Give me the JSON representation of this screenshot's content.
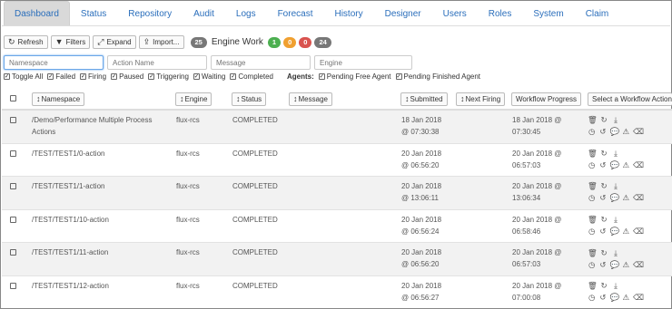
{
  "tabs": [
    "Dashboard",
    "Status",
    "Repository",
    "Audit",
    "Logs",
    "Forecast",
    "History",
    "Designer",
    "Users",
    "Roles",
    "System",
    "Claim"
  ],
  "active_tab": "Dashboard",
  "toolbar": {
    "refresh": "Refresh",
    "filters": "Filters",
    "expand": "Expand",
    "import": "Import...",
    "engine_count": "25",
    "engine_label": "Engine Work",
    "badge_green": "1",
    "badge_orange": "0",
    "badge_red": "0",
    "badge_gray": "24"
  },
  "filter_placeholders": {
    "namespace": "Namespace",
    "action_name": "Action Name",
    "message": "Message",
    "engine": "Engine"
  },
  "checkboxes": [
    "Toggle All",
    "Failed",
    "Firing",
    "Paused",
    "Triggering",
    "Waiting",
    "Completed"
  ],
  "agents_label": "Agents:",
  "agent_checkboxes": [
    "Pending Free Agent",
    "Pending Finished Agent"
  ],
  "columns": {
    "namespace": "Namespace",
    "engine": "Engine",
    "status": "Status",
    "message": "Message",
    "submitted": "Submitted",
    "next_firing": "Next Firing",
    "workflow_progress": "Workflow Progress",
    "select_action": "Select a Workflow Action"
  },
  "rows": [
    {
      "namespace": "/Demo/Performance Multiple Process",
      "namespace2": "Actions",
      "engine": "flux-rcs",
      "status": "COMPLETED",
      "submitted": "18 Jan 2018",
      "submitted2": "@ 07:30:38",
      "progress": "18 Jan 2018 @",
      "progress2": "07:30:45"
    },
    {
      "namespace": "/TEST/TEST1/0-action",
      "namespace2": "",
      "engine": "flux-rcs",
      "status": "COMPLETED",
      "submitted": "20 Jan 2018",
      "submitted2": "@ 06:56:20",
      "progress": "20 Jan 2018 @",
      "progress2": "06:57:03"
    },
    {
      "namespace": "/TEST/TEST1/1-action",
      "namespace2": "",
      "engine": "flux-rcs",
      "status": "COMPLETED",
      "submitted": "20 Jan 2018",
      "submitted2": "@ 13:06:11",
      "progress": "20 Jan 2018 @",
      "progress2": "13:06:34"
    },
    {
      "namespace": "/TEST/TEST1/10-action",
      "namespace2": "",
      "engine": "flux-rcs",
      "status": "COMPLETED",
      "submitted": "20 Jan 2018",
      "submitted2": "@ 06:56:24",
      "progress": "20 Jan 2018 @",
      "progress2": "06:58:46"
    },
    {
      "namespace": "/TEST/TEST1/11-action",
      "namespace2": "",
      "engine": "flux-rcs",
      "status": "COMPLETED",
      "submitted": "20 Jan 2018",
      "submitted2": "@ 06:56:20",
      "progress": "20 Jan 2018 @",
      "progress2": "06:57:03"
    },
    {
      "namespace": "/TEST/TEST1/12-action",
      "namespace2": "",
      "engine": "flux-rcs",
      "status": "COMPLETED",
      "submitted": "20 Jan 2018",
      "submitted2": "@ 06:56:27",
      "progress": "20 Jan 2018 @",
      "progress2": "07:00:08"
    }
  ],
  "colors": {
    "link": "#2a6ebb",
    "badge_green": "#4caf50",
    "badge_orange": "#f0a030",
    "badge_red": "#d9534f",
    "badge_gray": "#777777"
  }
}
